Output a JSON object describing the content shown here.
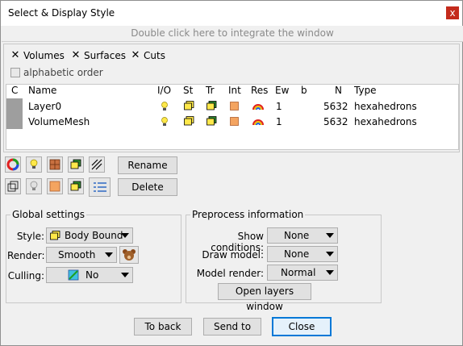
{
  "window": {
    "title": "Select & Display Style",
    "close_glyph": "x",
    "dock_text": "Double click here to integrate the window"
  },
  "filters": {
    "volumes_label": "Volumes",
    "surfaces_label": "Surfaces",
    "cuts_label": "Cuts",
    "alphabetic_label": "alphabetic order"
  },
  "table": {
    "headers": [
      "C",
      "Name",
      "I/O",
      "St",
      "Tr",
      "Int",
      "Res",
      "Ew",
      "b",
      "N",
      "Type"
    ],
    "rows": [
      {
        "name": "Layer0",
        "ew": "1",
        "n": "5632",
        "type": "hexahedrons"
      },
      {
        "name": "VolumeMesh",
        "ew": "1",
        "n": "5632",
        "type": "hexahedrons"
      }
    ]
  },
  "actions": {
    "rename_label": "Rename",
    "delete_label": "Delete"
  },
  "global": {
    "title": "Global settings",
    "style_label": "Style:",
    "style_value": "Body Bound",
    "render_label": "Render:",
    "render_value": "Smooth",
    "culling_label": "Culling:",
    "culling_value": "No"
  },
  "preprocess": {
    "title": "Preprocess information",
    "show_conditions_label": "Show conditions:",
    "show_conditions_value": "None",
    "draw_model_label": "Draw model:",
    "draw_model_value": "None",
    "model_render_label": "Model render:",
    "model_render_value": "Normal",
    "open_layers_label": "Open layers window"
  },
  "footer": {
    "to_back_label": "To back",
    "send_to_label": "Send to",
    "close_label": "Close"
  },
  "colors": {
    "close_red": "#c42b1c",
    "swatch_gray": "#9e9e9e",
    "yellow": "#ffe84a",
    "orange": "#f4a460",
    "green": "#2e8b2e"
  }
}
